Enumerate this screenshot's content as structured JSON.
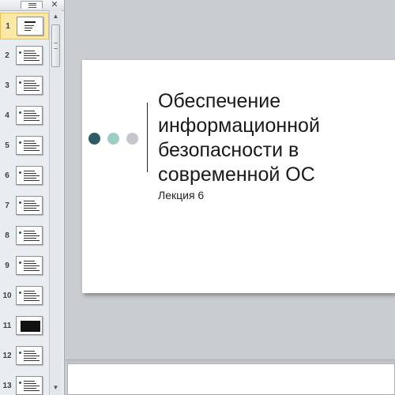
{
  "pane": {
    "close_glyph": "✕",
    "scroll_up": "▲",
    "scroll_down": "▼",
    "thumbnails": [
      {
        "num": "1",
        "style": "title",
        "selected": true
      },
      {
        "num": "2",
        "style": "text"
      },
      {
        "num": "3",
        "style": "text"
      },
      {
        "num": "4",
        "style": "text"
      },
      {
        "num": "5",
        "style": "text"
      },
      {
        "num": "6",
        "style": "text"
      },
      {
        "num": "7",
        "style": "text"
      },
      {
        "num": "8",
        "style": "text"
      },
      {
        "num": "9",
        "style": "text"
      },
      {
        "num": "10",
        "style": "text"
      },
      {
        "num": "11",
        "style": "dark"
      },
      {
        "num": "12",
        "style": "text"
      },
      {
        "num": "13",
        "style": "text"
      }
    ]
  },
  "slide": {
    "title": "Обеспечение информационной безопасности в современной ОС",
    "subtitle": "Лекция 6",
    "colors": {
      "dot1": "#2e5b66",
      "dot2": "#9fcdc6",
      "dot3": "#c5c7ca"
    }
  }
}
